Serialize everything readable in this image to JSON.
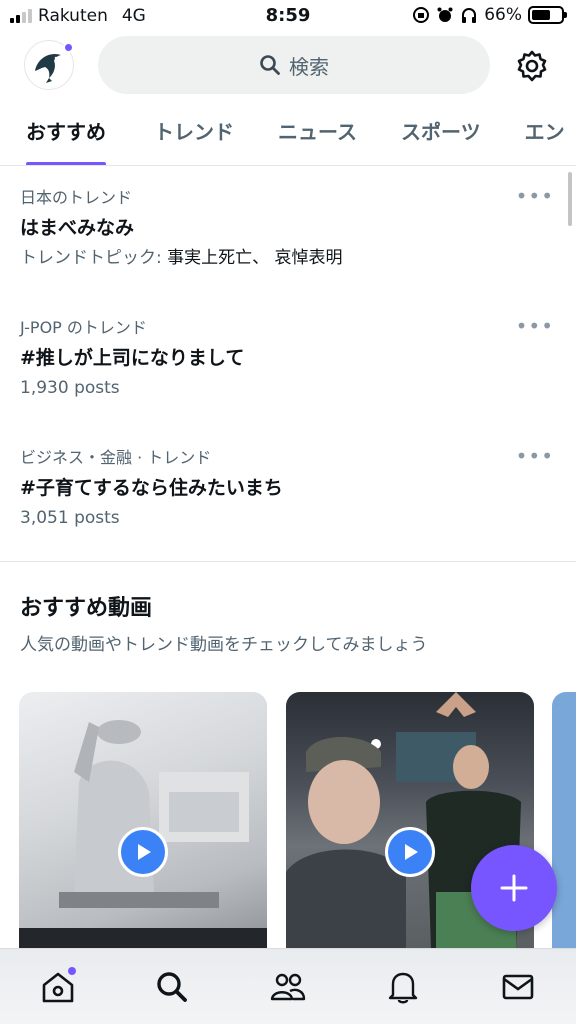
{
  "status_bar": {
    "carrier": "Rakuten",
    "network": "4G",
    "time": "8:59",
    "battery_percent": "66%",
    "battery_level": 0.66
  },
  "header": {
    "search_placeholder": "検索",
    "avatar_icon": "dolphin-logo-icon",
    "settings_icon": "gear-icon"
  },
  "tabs": [
    {
      "label": "おすすめ",
      "active": true
    },
    {
      "label": "トレンド",
      "active": false
    },
    {
      "label": "ニュース",
      "active": false
    },
    {
      "label": "スポーツ",
      "active": false
    },
    {
      "label": "エン",
      "active": false
    }
  ],
  "trends": [
    {
      "context": "日本のトレンド",
      "title": "はまべみなみ",
      "meta_prefix": "トレンドトピック: ",
      "meta_topics": "事実上死亡、 哀悼表明"
    },
    {
      "context": "J-POP のトレンド",
      "title": "#推しが上司になりまして",
      "meta_prefix": "1,930 posts",
      "meta_topics": ""
    },
    {
      "context": "ビジネス・金融 · トレンド",
      "title": "#子育てするなら住みたいまち",
      "meta_prefix": "3,051 posts",
      "meta_topics": ""
    }
  ],
  "videos": {
    "title": "おすすめ動画",
    "subtitle": "人気の動画やトレンド動画をチェックしてみましょう"
  },
  "colors": {
    "accent": "#7856ff",
    "play": "#3b82f6",
    "secondary_text": "#536471"
  },
  "bottom_nav": [
    "home-icon",
    "search-icon",
    "communities-icon",
    "bell-icon",
    "mail-icon"
  ]
}
